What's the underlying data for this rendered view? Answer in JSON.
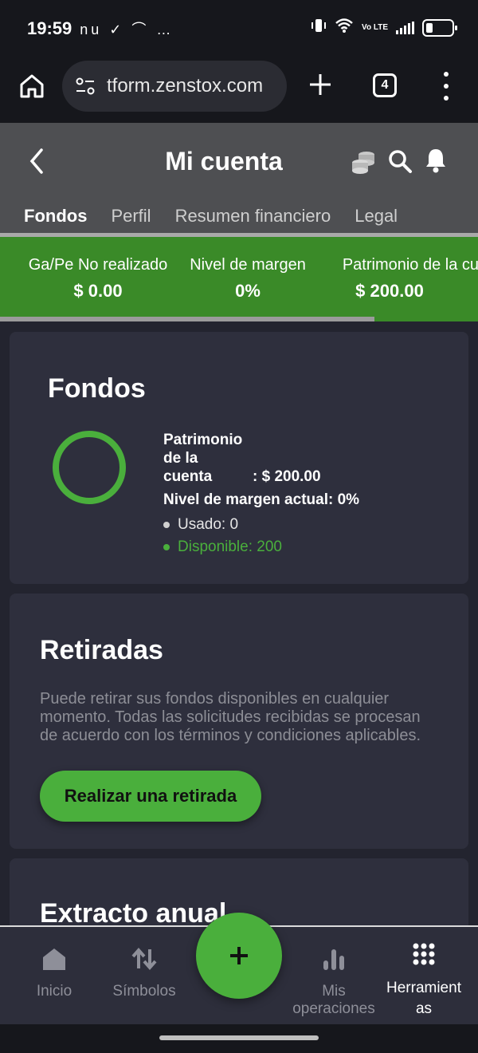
{
  "status_bar": {
    "time": "19:59",
    "notifications": "nu ✓ ⌒ …",
    "lte_label": "Vo LTE"
  },
  "browser": {
    "url": "tform.zenstox.com",
    "tab_count": "4"
  },
  "header": {
    "title": "Mi cuenta",
    "tabs": [
      {
        "label": "Fondos",
        "active": true
      },
      {
        "label": "Perfil",
        "active": false
      },
      {
        "label": "Resumen financiero",
        "active": false
      },
      {
        "label": "Legal",
        "active": false
      }
    ]
  },
  "metrics": [
    {
      "label": "Ga/Pe No realizado",
      "value": "$ 0.00"
    },
    {
      "label": "Nivel de margen",
      "value": "0%"
    },
    {
      "label": "Patrimonio de la cue",
      "value": "$ 200.00"
    }
  ],
  "fondos": {
    "title": "Fondos",
    "equity_label_1": "Patrimonio",
    "equity_label_2": "de la",
    "equity_label_3": "cuenta",
    "equity_value": ": $ 200.00",
    "margin_level": "Nivel de margen actual: 0%",
    "used": "Usado: 0",
    "available": "Disponible: 200",
    "ring_used_fraction": 0
  },
  "retiradas": {
    "title": "Retiradas",
    "description": "Puede retirar sus fondos disponibles en cualquier momento. Todas las solicitudes recibidas se procesan de acuerdo con los términos y condiciones aplicables.",
    "button_label": "Realizar una retirada"
  },
  "extracto": {
    "title": "Extracto anual"
  },
  "bottom_nav": {
    "items": [
      {
        "label": "Inicio"
      },
      {
        "label": "Símbolos"
      },
      {
        "label": "Mis operaciones"
      },
      {
        "label": "Herramientas"
      }
    ]
  },
  "colors": {
    "accent": "#4aaf3c",
    "metrics_bg": "#3a8a28",
    "card_bg": "#2e2f3d",
    "page_bg": "#23242f"
  }
}
